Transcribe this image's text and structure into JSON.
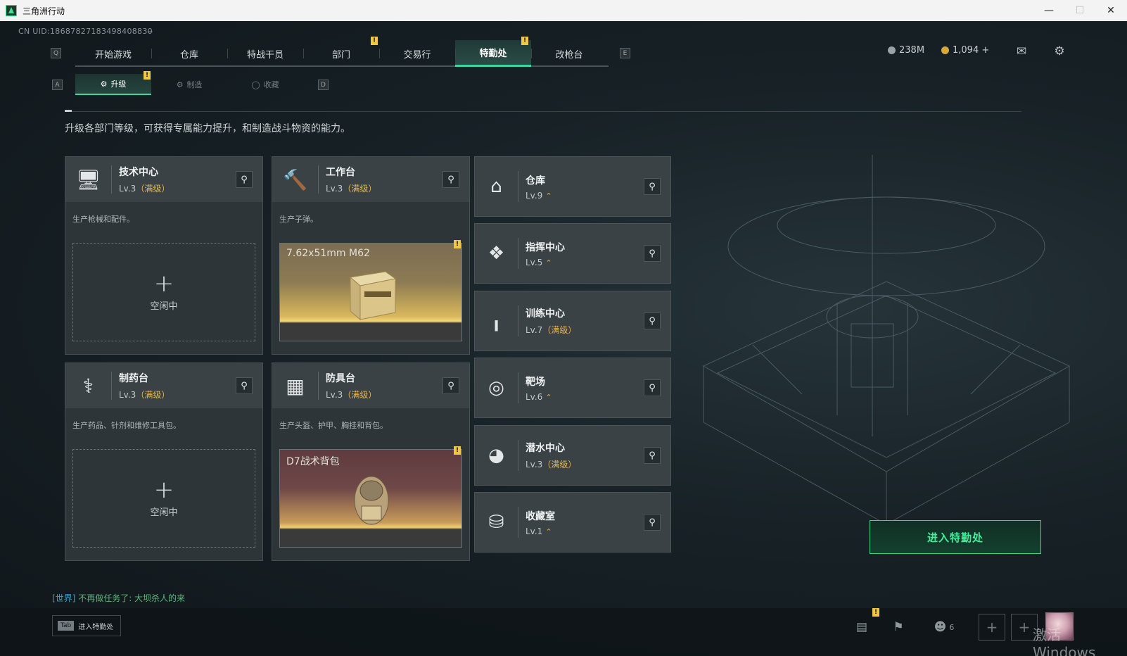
{
  "window": {
    "title": "三角洲行动"
  },
  "uid": "CN UID:18687827183498408830̶",
  "nav": {
    "left_key": "Q",
    "right_key": "E",
    "tabs": [
      {
        "label": "开始游戏"
      },
      {
        "label": "仓库"
      },
      {
        "label": "特战干员"
      },
      {
        "label": "部门"
      },
      {
        "label": "交易行"
      },
      {
        "label": "特勤处"
      },
      {
        "label": "改枪台"
      }
    ],
    "active_index": 5
  },
  "currency": {
    "silver": "238M",
    "gold": "1,094 +"
  },
  "subnav": {
    "left_key": "A",
    "right_key": "D",
    "tabs": [
      {
        "label": "升级",
        "icon": "upgrade-icon"
      },
      {
        "label": "制造",
        "icon": "craft-icon"
      },
      {
        "label": "收藏",
        "icon": "collect-icon"
      }
    ]
  },
  "description": "升级各部门等级，可获得专属能力提升，和制造战斗物资的能力。",
  "stations": [
    {
      "name": "技术中心",
      "level": "Lv.3",
      "max": "（满级）",
      "desc": "生产枪械和配件。",
      "slot": {
        "type": "empty",
        "plus": "+",
        "label": "空闲中"
      },
      "icon": "computer-icon"
    },
    {
      "name": "工作台",
      "level": "Lv.3",
      "max": "（满级）",
      "desc": "生产子弹。",
      "slot": {
        "type": "item",
        "item": "7.62x51mm M62"
      },
      "icon": "tools-icon"
    },
    {
      "name": "制药台",
      "level": "Lv.3",
      "max": "（满级）",
      "desc": "生产药品、针剂和维修工具包。",
      "slot": {
        "type": "empty",
        "plus": "+",
        "label": "空闲中"
      },
      "icon": "microscope-icon"
    },
    {
      "name": "防具台",
      "level": "Lv.3",
      "max": "（满级）",
      "desc": "生产头盔、护甲、胸挂和背包。",
      "slot": {
        "type": "item",
        "item": "D7战术背包"
      },
      "icon": "cubes-icon"
    }
  ],
  "facilities": [
    {
      "name": "仓库",
      "level": "Lv.9",
      "max": "",
      "upgradable": true,
      "icon": "warehouse-icon"
    },
    {
      "name": "指挥中心",
      "level": "Lv.5",
      "max": "",
      "upgradable": true,
      "icon": "command-icon"
    },
    {
      "name": "训练中心",
      "level": "Lv.7",
      "max": "（满级）",
      "upgradable": false,
      "icon": "dumbbell-icon"
    },
    {
      "name": "靶场",
      "level": "Lv.6",
      "max": "",
      "upgradable": true,
      "icon": "target-icon"
    },
    {
      "name": "潜水中心",
      "level": "Lv.3",
      "max": "（满级）",
      "upgradable": false,
      "icon": "diving-icon"
    },
    {
      "name": "收藏室",
      "level": "Lv.1",
      "max": "",
      "upgradable": true,
      "icon": "collection-icon"
    }
  ],
  "enter_button": "进入特勤处",
  "chat": {
    "channel": "[世界]",
    "message": "不再做任务了: 大坝杀人的来"
  },
  "bottom": {
    "tab_key": "Tab",
    "tab_label": "进入特勤处",
    "friends_count": "6"
  },
  "watermark": "激活 Windows",
  "colors": {
    "accent": "#37d8a0",
    "gold": "#e6b54a",
    "badge": "#f2c744"
  }
}
